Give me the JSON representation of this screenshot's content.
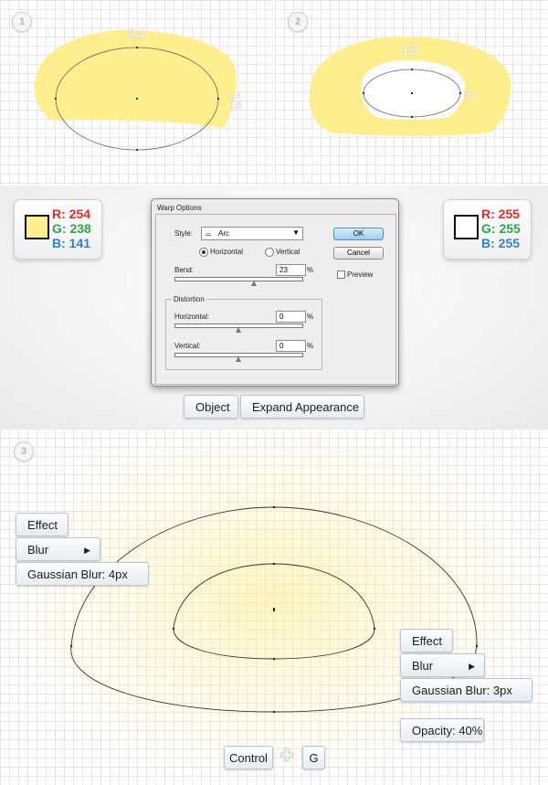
{
  "step1": {
    "number": "1",
    "width_label": "24",
    "height_label": "15"
  },
  "step2": {
    "number": "2",
    "width_label": "12",
    "height_label": "7"
  },
  "step3": {
    "number": "3"
  },
  "swatch_left": {
    "color": "#FEEE8D",
    "r": "R: 254",
    "g": "G: 238",
    "b": "B: 141"
  },
  "swatch_right": {
    "color": "#FFFFFF",
    "r": "R: 255",
    "g": "G: 255",
    "b": "B: 255"
  },
  "warp_dialog": {
    "title": "Warp Options",
    "style_label": "Style:",
    "style_value": "Arc",
    "horizontal_label": "Horizontal",
    "vertical_label": "Vertical",
    "bend_label": "Bend:",
    "bend_value": "23",
    "percent": "%",
    "distortion_label": "Distortion",
    "dist_horizontal_label": "Horizontal:",
    "dist_horizontal_value": "0",
    "dist_vertical_label": "Vertical:",
    "dist_vertical_value": "0",
    "ok_label": "OK",
    "cancel_label": "Cancel",
    "preview_label": "Preview"
  },
  "menu_path": {
    "object": "Object",
    "expand": "Expand Appearance"
  },
  "effect_left": {
    "effect": "Effect",
    "blur": "Blur",
    "gaussian": "Gaussian Blur: 4px"
  },
  "effect_right": {
    "effect": "Effect",
    "blur": "Blur",
    "gaussian": "Gaussian Blur: 3px",
    "opacity": "Opacity: 40%"
  },
  "shortcut": {
    "control": "Control",
    "key": "G"
  },
  "colors": {
    "fill_yellow": "#FEEE8D",
    "button_border": "#B9C5D3"
  }
}
